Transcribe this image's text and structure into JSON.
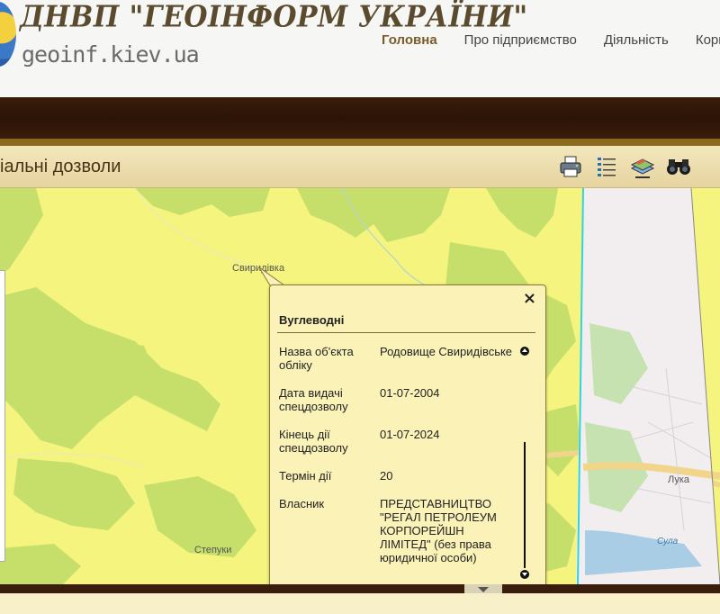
{
  "header": {
    "title": "ДНВП \"ГЕОІНФОРМ УКРАЇНИ\"",
    "url": "geoinf.kiev.ua"
  },
  "nav": {
    "items": [
      {
        "label": "Головна",
        "active": true
      },
      {
        "label": "Про підприємство",
        "active": false
      },
      {
        "label": "Діяльність",
        "active": false
      },
      {
        "label": "Кори",
        "active": false
      }
    ]
  },
  "toolbar": {
    "title": "іальні дозволи",
    "icons": [
      "printer-icon",
      "list-icon",
      "layers-icon",
      "binoculars-icon"
    ]
  },
  "map": {
    "labels": [
      "Свиридівка",
      "Степуки",
      "Лука",
      "Сула"
    ]
  },
  "popup": {
    "close": "×",
    "header": "Вуглеводні",
    "rows": [
      {
        "key": "Назва об'єкта обліку",
        "value": "Родовище Свиридівське"
      },
      {
        "key": "Дата видачі спецдозволу",
        "value": "01-07-2004"
      },
      {
        "key": "Кінець дії спецдозволу",
        "value": "01-07-2024"
      },
      {
        "key": "Термін дії",
        "value": "20"
      },
      {
        "key": "Власник",
        "value": "ПРЕДСТАВНИЦТВО \"РЕГАЛ ПЕТРОЛЕУМ КОРПОРЕЙШН ЛІМІТЕД\" (без права юридичної особи)"
      }
    ]
  },
  "colors": {
    "map_base": "#f4f47e",
    "forest": "#c6df6b",
    "brand_dark": "#3a1d0c",
    "brand_gold": "#8a6a1c"
  }
}
